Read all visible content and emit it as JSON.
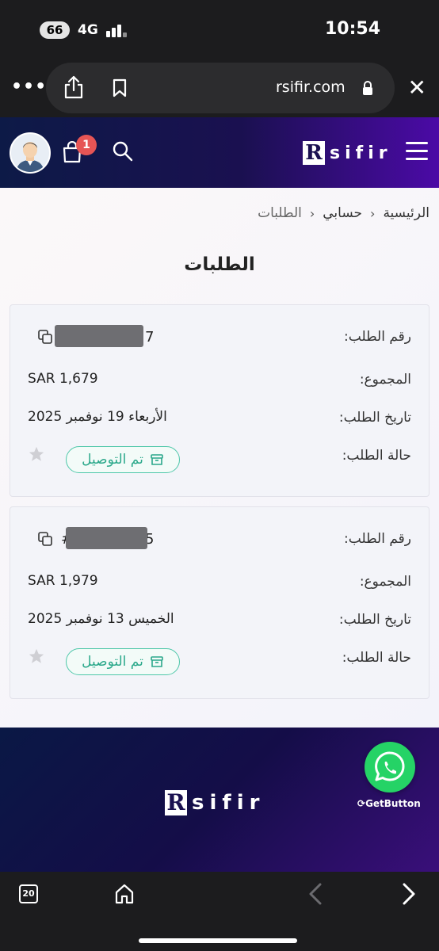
{
  "status_bar": {
    "battery": "66",
    "network": "4G",
    "time": "10:54"
  },
  "browser": {
    "url": "rsifir.com",
    "more_icon": "ellipsis-icon",
    "share_icon": "share-icon",
    "bookmark_icon": "bookmark-icon",
    "lock_icon": "lock-icon",
    "close_icon": "close-icon"
  },
  "header": {
    "cart_count": "1",
    "logo_letter": "R",
    "logo_text": "sifir"
  },
  "breadcrumb": {
    "home": "الرئيسية",
    "account": "حسابي",
    "current": "الطلبات"
  },
  "page_title": "الطلبات",
  "orders": [
    {
      "number_label": "رقم الطلب:",
      "number_suffix": "7",
      "total_label": "المجموع:",
      "total": "SAR 1,679",
      "date_label": "تاريخ الطلب:",
      "date": "الأربعاء 19 نوفمبر 2025",
      "status_label": "حالة الطلب:",
      "status": "تم التوصيل"
    },
    {
      "number_label": "رقم الطلب:",
      "number_prefix": "#",
      "number_suffix": "5",
      "total_label": "المجموع:",
      "total": "SAR 1,979",
      "date_label": "تاريخ الطلب:",
      "date": "الخميس 13 نوفمبر 2025",
      "status_label": "حالة الطلب:",
      "status": "تم التوصيل"
    }
  ],
  "footer": {
    "logo_letter": "R",
    "logo_text": "sifir",
    "getbutton": "GetButton"
  },
  "toolbar": {
    "tabs_count": "20"
  },
  "colors": {
    "header_start": "#0d1a47",
    "header_end": "#4b0aa6",
    "status_green": "#2aa88a",
    "badge_red": "#e65555",
    "whatsapp_green": "#25d366"
  }
}
